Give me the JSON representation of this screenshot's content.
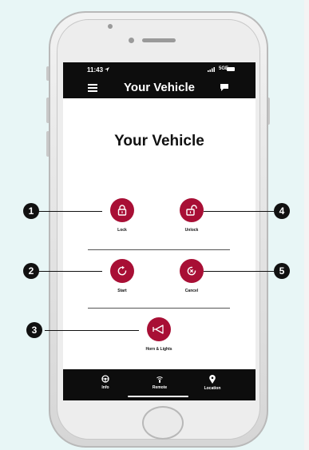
{
  "status_bar": {
    "time": "11:43",
    "signal": "5GE"
  },
  "nav": {
    "title": "Your Vehicle"
  },
  "main": {
    "heading": "Your Vehicle",
    "actions": [
      {
        "label": "Lock",
        "icon": "padlock-locked-icon"
      },
      {
        "label": "Unlock",
        "icon": "padlock-unlocked-icon"
      },
      {
        "label": "Start",
        "icon": "refresh-arrow-icon"
      },
      {
        "label": "Cancel",
        "icon": "cancel-x-icon"
      },
      {
        "label": "Horn & Lights",
        "icon": "horn-icon"
      }
    ]
  },
  "tabs": [
    {
      "label": "Info",
      "icon": "steering-wheel-icon"
    },
    {
      "label": "Remote",
      "icon": "wireless-remote-icon"
    },
    {
      "label": "Location",
      "icon": "map-pin-icon"
    }
  ],
  "callouts": [
    "1",
    "2",
    "3",
    "4",
    "5"
  ],
  "colors": {
    "accent": "#a80f35",
    "bar": "#0d0d0d",
    "background": "#e8f6f6"
  }
}
